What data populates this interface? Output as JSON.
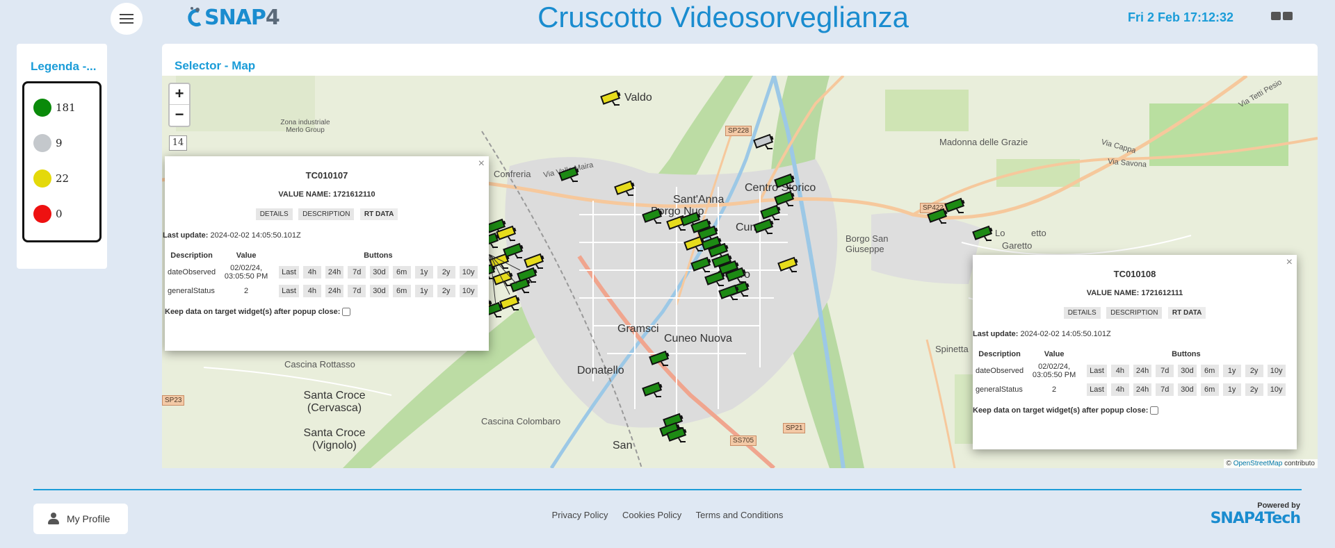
{
  "header": {
    "title": "Cruscotto Videosorveglianza",
    "clock": "Fri 2 Feb 17:12:32",
    "logo_main": "SNAP",
    "logo_four": "4"
  },
  "legend": {
    "title": "Legenda -...",
    "items": [
      {
        "color": "#0a8a0a",
        "count": "181"
      },
      {
        "color": "#c4c8cc",
        "count": "9"
      },
      {
        "color": "#e4d90a",
        "count": "22"
      },
      {
        "color": "#ee1111",
        "count": "0"
      }
    ]
  },
  "map_widget": {
    "title": "Selector - Map",
    "zoom_in": "+",
    "zoom_out": "−",
    "zoom_level": "14",
    "attribution_prefix": "©",
    "attribution_link": "OpenStreetMap",
    "attribution_suffix": "contributo",
    "places": [
      "Madonna delle Grazie",
      "Confreria",
      "Sant'Anna",
      "Borgo Nuo",
      "Centro Storico",
      "Cune",
      "Centro",
      "Gramsci",
      "Cuneo Nuova",
      "Donatello",
      "Borgo San Giuseppe",
      "Lo",
      "etto",
      "Garetto",
      "Spinetta",
      "Cascina Rottasso",
      "Santa Croce (Cervasca)",
      "Santa Croce (Vignolo)",
      "Cascina Colombaro",
      "San",
      "Zona industriale Merlo Group",
      "Via Valle Maira",
      "Via Savona",
      "Via Cappa",
      "Via Tetti Pesio",
      "Valdo"
    ],
    "road_shields": [
      "SP228",
      "SP422",
      "SP23",
      "SS705",
      "SP21"
    ]
  },
  "popups": [
    {
      "id": "TC010107",
      "value_name": "VALUE NAME: 1721612110",
      "tabs": [
        "DETAILS",
        "DESCRIPTION",
        "RT DATA"
      ],
      "last_update_label": "Last update:",
      "last_update": "2024-02-02 14:05:50.101Z",
      "headers": [
        "Description",
        "Value",
        "Buttons"
      ],
      "rows": [
        {
          "desc": "dateObserved",
          "value": "02/02/24, 03:05:50 PM"
        },
        {
          "desc": "generalStatus",
          "value": "2"
        }
      ],
      "buttons": [
        "Last",
        "4h",
        "24h",
        "7d",
        "30d",
        "6m",
        "1y",
        "2y",
        "10y"
      ],
      "keep_label": "Keep data on target widget(s) after popup close:"
    },
    {
      "id": "TC010108",
      "value_name": "VALUE NAME: 1721612111",
      "tabs": [
        "DETAILS",
        "DESCRIPTION",
        "RT DATA"
      ],
      "last_update_label": "Last update:",
      "last_update": "2024-02-02 14:05:50.101Z",
      "headers": [
        "Description",
        "Value",
        "Buttons"
      ],
      "rows": [
        {
          "desc": "dateObserved",
          "value": "02/02/24, 03:05:50 PM"
        },
        {
          "desc": "generalStatus",
          "value": "2"
        }
      ],
      "buttons": [
        "Last",
        "4h",
        "24h",
        "7d",
        "30d",
        "6m",
        "1y",
        "2y",
        "10y"
      ],
      "keep_label": "Keep data on target widget(s) after popup close:"
    }
  ],
  "footer": {
    "profile_label": "My Profile",
    "links": [
      "Privacy Policy",
      "Cookies Policy",
      "Terms and Conditions"
    ],
    "powered_by": "Powered by",
    "powered_brand": "SNAP4Tech"
  }
}
